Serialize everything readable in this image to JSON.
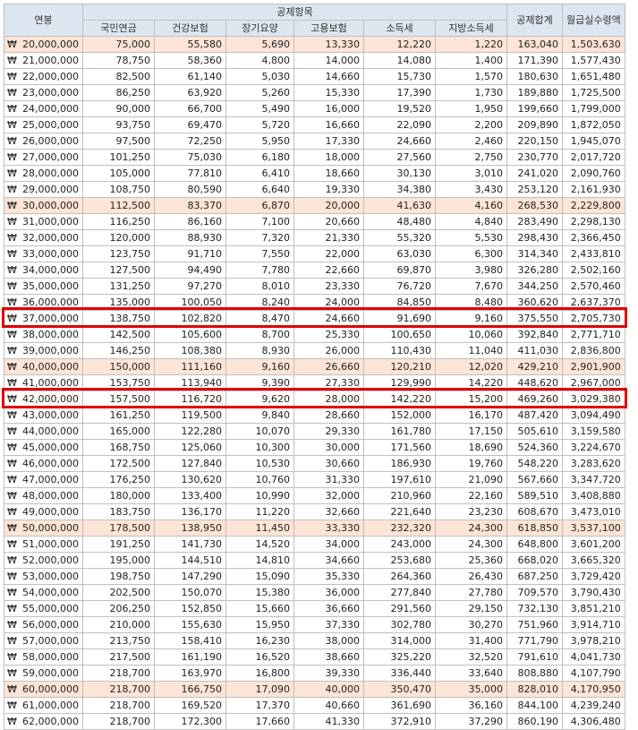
{
  "header": {
    "salary": "연봉",
    "deduction_group": "공제항목",
    "pension": "국민연금",
    "health": "건강보험",
    "longterm": "장기요양",
    "employment": "고용보험",
    "income_tax": "소득세",
    "local_tax": "지방소득세",
    "total": "공제합계",
    "net_monthly": "월급실수령액"
  },
  "currency_symbol": "₩",
  "highlight_color": "#fce4d6",
  "header_color": "#dce6f1",
  "box_color": "#e00000",
  "rows": [
    {
      "salary": "20,000,000",
      "pension": "75,000",
      "health": "55,580",
      "longterm": "5,690",
      "employment": "13,330",
      "income_tax": "12,220",
      "local_tax": "1,220",
      "total": "163,040",
      "net": "1,503,630",
      "hl": true,
      "box": false
    },
    {
      "salary": "21,000,000",
      "pension": "78,750",
      "health": "58,360",
      "longterm": "4,800",
      "employment": "14,000",
      "income_tax": "14,080",
      "local_tax": "1,400",
      "total": "171,390",
      "net": "1,577,430",
      "hl": false,
      "box": false
    },
    {
      "salary": "22,000,000",
      "pension": "82,500",
      "health": "61,140",
      "longterm": "5,030",
      "employment": "14,660",
      "income_tax": "15,730",
      "local_tax": "1,570",
      "total": "180,630",
      "net": "1,651,480",
      "hl": false,
      "box": false
    },
    {
      "salary": "23,000,000",
      "pension": "86,250",
      "health": "63,920",
      "longterm": "5,260",
      "employment": "15,330",
      "income_tax": "17,390",
      "local_tax": "1,730",
      "total": "189,880",
      "net": "1,725,500",
      "hl": false,
      "box": false
    },
    {
      "salary": "24,000,000",
      "pension": "90,000",
      "health": "66,700",
      "longterm": "5,490",
      "employment": "16,000",
      "income_tax": "19,520",
      "local_tax": "1,950",
      "total": "199,660",
      "net": "1,799,000",
      "hl": false,
      "box": false
    },
    {
      "salary": "25,000,000",
      "pension": "93,750",
      "health": "69,470",
      "longterm": "5,720",
      "employment": "16,660",
      "income_tax": "22,090",
      "local_tax": "2,200",
      "total": "209,890",
      "net": "1,872,050",
      "hl": false,
      "box": false
    },
    {
      "salary": "26,000,000",
      "pension": "97,500",
      "health": "72,250",
      "longterm": "5,950",
      "employment": "17,330",
      "income_tax": "24,660",
      "local_tax": "2,460",
      "total": "220,150",
      "net": "1,945,070",
      "hl": false,
      "box": false
    },
    {
      "salary": "27,000,000",
      "pension": "101,250",
      "health": "75,030",
      "longterm": "6,180",
      "employment": "18,000",
      "income_tax": "27,560",
      "local_tax": "2,750",
      "total": "230,770",
      "net": "2,017,720",
      "hl": false,
      "box": false
    },
    {
      "salary": "28,000,000",
      "pension": "105,000",
      "health": "77,810",
      "longterm": "6,410",
      "employment": "18,660",
      "income_tax": "30,130",
      "local_tax": "3,010",
      "total": "241,020",
      "net": "2,090,760",
      "hl": false,
      "box": false
    },
    {
      "salary": "29,000,000",
      "pension": "108,750",
      "health": "80,590",
      "longterm": "6,640",
      "employment": "19,330",
      "income_tax": "34,380",
      "local_tax": "3,430",
      "total": "253,120",
      "net": "2,161,930",
      "hl": false,
      "box": false
    },
    {
      "salary": "30,000,000",
      "pension": "112,500",
      "health": "83,370",
      "longterm": "6,870",
      "employment": "20,000",
      "income_tax": "41,630",
      "local_tax": "4,160",
      "total": "268,530",
      "net": "2,229,800",
      "hl": true,
      "box": false
    },
    {
      "salary": "31,000,000",
      "pension": "116,250",
      "health": "86,160",
      "longterm": "7,100",
      "employment": "20,660",
      "income_tax": "48,480",
      "local_tax": "4,840",
      "total": "283,490",
      "net": "2,298,130",
      "hl": false,
      "box": false
    },
    {
      "salary": "32,000,000",
      "pension": "120,000",
      "health": "88,930",
      "longterm": "7,320",
      "employment": "21,330",
      "income_tax": "55,320",
      "local_tax": "5,530",
      "total": "298,430",
      "net": "2,366,450",
      "hl": false,
      "box": false
    },
    {
      "salary": "33,000,000",
      "pension": "123,750",
      "health": "91,710",
      "longterm": "7,550",
      "employment": "22,000",
      "income_tax": "63,030",
      "local_tax": "6,300",
      "total": "314,340",
      "net": "2,433,810",
      "hl": false,
      "box": false
    },
    {
      "salary": "34,000,000",
      "pension": "127,500",
      "health": "94,490",
      "longterm": "7,780",
      "employment": "22,660",
      "income_tax": "69,870",
      "local_tax": "3,980",
      "total": "326,280",
      "net": "2,502,160",
      "hl": false,
      "box": false
    },
    {
      "salary": "35,000,000",
      "pension": "131,250",
      "health": "97,270",
      "longterm": "8,010",
      "employment": "23,330",
      "income_tax": "76,720",
      "local_tax": "7,670",
      "total": "344,250",
      "net": "2,570,460",
      "hl": false,
      "box": false
    },
    {
      "salary": "36,000,000",
      "pension": "135,000",
      "health": "100,050",
      "longterm": "8,240",
      "employment": "24,000",
      "income_tax": "84,850",
      "local_tax": "8,480",
      "total": "360,620",
      "net": "2,637,370",
      "hl": false,
      "box": false
    },
    {
      "salary": "37,000,000",
      "pension": "138,750",
      "health": "102,820",
      "longterm": "8,470",
      "employment": "24,660",
      "income_tax": "91,690",
      "local_tax": "9,160",
      "total": "375,550",
      "net": "2,705,730",
      "hl": false,
      "box": true
    },
    {
      "salary": "38,000,000",
      "pension": "142,500",
      "health": "105,600",
      "longterm": "8,700",
      "employment": "25,330",
      "income_tax": "100,650",
      "local_tax": "10,060",
      "total": "392,840",
      "net": "2,771,710",
      "hl": false,
      "box": false
    },
    {
      "salary": "39,000,000",
      "pension": "146,250",
      "health": "108,380",
      "longterm": "8,930",
      "employment": "26,000",
      "income_tax": "110,430",
      "local_tax": "11,040",
      "total": "411,030",
      "net": "2,836,800",
      "hl": false,
      "box": false
    },
    {
      "salary": "40,000,000",
      "pension": "150,000",
      "health": "111,160",
      "longterm": "9,160",
      "employment": "26,660",
      "income_tax": "120,210",
      "local_tax": "12,020",
      "total": "429,210",
      "net": "2,901,900",
      "hl": true,
      "box": false
    },
    {
      "salary": "41,000,000",
      "pension": "153,750",
      "health": "113,940",
      "longterm": "9,390",
      "employment": "27,330",
      "income_tax": "129,990",
      "local_tax": "14,220",
      "total": "448,620",
      "net": "2,967,000",
      "hl": false,
      "box": false
    },
    {
      "salary": "42,000,000",
      "pension": "157,500",
      "health": "116,720",
      "longterm": "9,620",
      "employment": "28,000",
      "income_tax": "142,220",
      "local_tax": "15,200",
      "total": "469,260",
      "net": "3,029,380",
      "hl": false,
      "box": true
    },
    {
      "salary": "43,000,000",
      "pension": "161,250",
      "health": "119,500",
      "longterm": "9,840",
      "employment": "28,660",
      "income_tax": "152,000",
      "local_tax": "16,170",
      "total": "487,420",
      "net": "3,094,490",
      "hl": false,
      "box": false
    },
    {
      "salary": "44,000,000",
      "pension": "165,000",
      "health": "122,280",
      "longterm": "10,070",
      "employment": "29,330",
      "income_tax": "161,780",
      "local_tax": "17,150",
      "total": "505,610",
      "net": "3,159,580",
      "hl": false,
      "box": false
    },
    {
      "salary": "45,000,000",
      "pension": "168,750",
      "health": "125,060",
      "longterm": "10,300",
      "employment": "30,000",
      "income_tax": "171,560",
      "local_tax": "18,690",
      "total": "524,360",
      "net": "3,224,670",
      "hl": false,
      "box": false
    },
    {
      "salary": "46,000,000",
      "pension": "172,500",
      "health": "127,840",
      "longterm": "10,530",
      "employment": "30,660",
      "income_tax": "186,930",
      "local_tax": "19,760",
      "total": "548,220",
      "net": "3,283,620",
      "hl": false,
      "box": false
    },
    {
      "salary": "47,000,000",
      "pension": "176,250",
      "health": "130,620",
      "longterm": "10,760",
      "employment": "31,330",
      "income_tax": "197,610",
      "local_tax": "21,090",
      "total": "567,660",
      "net": "3,347,720",
      "hl": false,
      "box": false
    },
    {
      "salary": "48,000,000",
      "pension": "180,000",
      "health": "133,400",
      "longterm": "10,990",
      "employment": "32,000",
      "income_tax": "210,960",
      "local_tax": "22,160",
      "total": "589,510",
      "net": "3,408,880",
      "hl": false,
      "box": false
    },
    {
      "salary": "49,000,000",
      "pension": "183,750",
      "health": "136,170",
      "longterm": "11,220",
      "employment": "32,660",
      "income_tax": "221,640",
      "local_tax": "23,230",
      "total": "608,670",
      "net": "3,473,010",
      "hl": false,
      "box": false
    },
    {
      "salary": "50,000,000",
      "pension": "178,500",
      "health": "138,950",
      "longterm": "11,450",
      "employment": "33,330",
      "income_tax": "232,320",
      "local_tax": "24,300",
      "total": "618,850",
      "net": "3,537,100",
      "hl": true,
      "box": false
    },
    {
      "salary": "51,000,000",
      "pension": "191,250",
      "health": "141,730",
      "longterm": "14,520",
      "employment": "34,000",
      "income_tax": "243,000",
      "local_tax": "24,300",
      "total": "648,800",
      "net": "3,601,200",
      "hl": false,
      "box": false
    },
    {
      "salary": "52,000,000",
      "pension": "195,000",
      "health": "144,510",
      "longterm": "14,810",
      "employment": "34,660",
      "income_tax": "253,680",
      "local_tax": "25,360",
      "total": "668,020",
      "net": "3,665,320",
      "hl": false,
      "box": false
    },
    {
      "salary": "53,000,000",
      "pension": "198,750",
      "health": "147,290",
      "longterm": "15,090",
      "employment": "35,330",
      "income_tax": "264,360",
      "local_tax": "26,430",
      "total": "687,250",
      "net": "3,729,420",
      "hl": false,
      "box": false
    },
    {
      "salary": "54,000,000",
      "pension": "202,500",
      "health": "150,070",
      "longterm": "15,380",
      "employment": "36,000",
      "income_tax": "277,840",
      "local_tax": "27,780",
      "total": "709,570",
      "net": "3,790,430",
      "hl": false,
      "box": false
    },
    {
      "salary": "55,000,000",
      "pension": "206,250",
      "health": "152,850",
      "longterm": "15,660",
      "employment": "36,660",
      "income_tax": "291,560",
      "local_tax": "29,150",
      "total": "732,130",
      "net": "3,851,210",
      "hl": false,
      "box": false
    },
    {
      "salary": "56,000,000",
      "pension": "210,000",
      "health": "155,630",
      "longterm": "15,950",
      "employment": "37,330",
      "income_tax": "302,780",
      "local_tax": "30,270",
      "total": "751,960",
      "net": "3,914,710",
      "hl": false,
      "box": false
    },
    {
      "salary": "57,000,000",
      "pension": "213,750",
      "health": "158,410",
      "longterm": "16,230",
      "employment": "38,000",
      "income_tax": "314,000",
      "local_tax": "31,400",
      "total": "771,790",
      "net": "3,978,210",
      "hl": false,
      "box": false
    },
    {
      "salary": "58,000,000",
      "pension": "217,500",
      "health": "161,190",
      "longterm": "16,520",
      "employment": "38,660",
      "income_tax": "325,220",
      "local_tax": "32,520",
      "total": "791,610",
      "net": "4,041,730",
      "hl": false,
      "box": false
    },
    {
      "salary": "59,000,000",
      "pension": "218,700",
      "health": "163,970",
      "longterm": "16,800",
      "employment": "39,330",
      "income_tax": "336,440",
      "local_tax": "33,640",
      "total": "808,880",
      "net": "4,107,790",
      "hl": false,
      "box": false
    },
    {
      "salary": "60,000,000",
      "pension": "218,700",
      "health": "166,750",
      "longterm": "17,090",
      "employment": "40,000",
      "income_tax": "350,470",
      "local_tax": "35,000",
      "total": "828,010",
      "net": "4,170,950",
      "hl": true,
      "box": false
    },
    {
      "salary": "61,000,000",
      "pension": "218,700",
      "health": "169,520",
      "longterm": "17,370",
      "employment": "40,660",
      "income_tax": "361,690",
      "local_tax": "36,160",
      "total": "844,100",
      "net": "4,239,240",
      "hl": false,
      "box": false
    },
    {
      "salary": "62,000,000",
      "pension": "218,700",
      "health": "172,300",
      "longterm": "17,660",
      "employment": "41,330",
      "income_tax": "372,910",
      "local_tax": "37,290",
      "total": "860,190",
      "net": "4,306,480",
      "hl": false,
      "box": false
    }
  ]
}
